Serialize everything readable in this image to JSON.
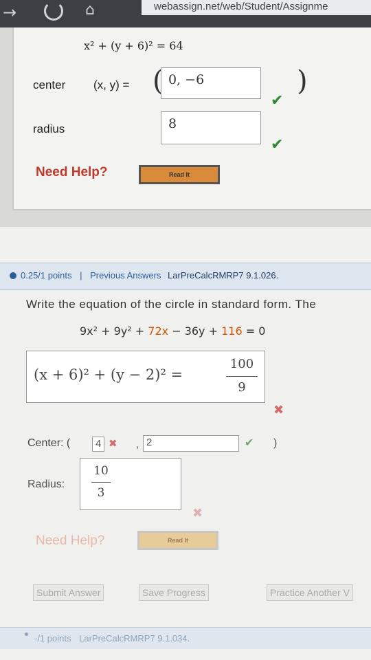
{
  "browser": {
    "url": "webassign.net/web/Student/Assignme",
    "back_icon": "→",
    "home_icon": "⌂"
  },
  "upper_question": {
    "equation": "x² + (y + 6)² = 64",
    "center_label": "center",
    "center_xy_label": "(x, y) =",
    "center_value": "0, −6",
    "paren_open": "(",
    "paren_close": ")",
    "radius_label": "radius",
    "radius_value": "8",
    "check_icon": "✔",
    "need_help": "Need Help?",
    "read_it": "Read It"
  },
  "lower_question": {
    "points": "0.25/1 points",
    "separator": "|",
    "previous_answers": "Previous Answers",
    "problem_id": "LarPreCalcRMRP7 9.1.026.",
    "prompt": "Write the equation of the circle in standard form. The",
    "equation_parts": {
      "a": "9x² + 9y² + ",
      "b": "72x",
      "c": " − 36y + ",
      "d": "116",
      "e": " = 0"
    },
    "standard_form": "(x + 6)² + (y − 2)² =",
    "rhs_num": "100",
    "rhs_den": "9",
    "center_label": "Center: (",
    "center_x": "4",
    "center_sep": ",",
    "center_y": "2",
    "center_close": ")",
    "radius_label": "Radius:",
    "radius_num": "10",
    "radius_den": "3",
    "cross_icon": "✖",
    "check_icon": "✔",
    "need_help": "Need Help?",
    "read_it": "Read It",
    "submit": "Submit Answer",
    "save": "Save Progress",
    "practice": "Practice Another V"
  },
  "next_question": {
    "points": "-/1 points",
    "problem_id": "LarPreCalcRMRP7 9.1.034."
  },
  "colors": {
    "correct": "#2d8a2d",
    "incorrect": "#d46a6a",
    "link": "#2a5d9a",
    "help": "#c0392b"
  }
}
